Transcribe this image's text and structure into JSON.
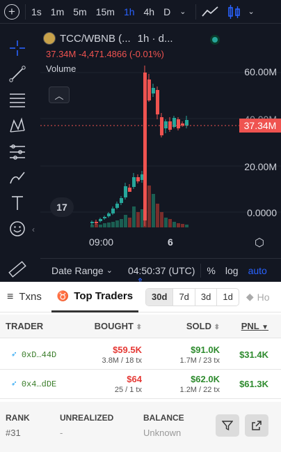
{
  "toolbar": {
    "timeframes": [
      "1s",
      "1m",
      "5m",
      "15m",
      "1h",
      "4h",
      "D"
    ],
    "active_timeframe": "1h"
  },
  "chart_header": {
    "symbol": "TCC/WBNB (...",
    "interval": "1h · d...",
    "ohlc_line": "37.34M -4,471.4866 (-0.01%)",
    "volume_label": "Volume"
  },
  "chart_data": {
    "type": "candlestick",
    "y_ticks": [
      "60.00M",
      "40.00M",
      "20.00M",
      "0.0000"
    ],
    "x_ticks": [
      "09:00",
      "6"
    ],
    "current_price_label": "37.34M",
    "accent_up": "#26a69a",
    "accent_down": "#ef5350"
  },
  "bottom_bar": {
    "date_range": "Date Range",
    "clock": "04:50:37 (UTC)",
    "percent": "%",
    "log": "log",
    "auto": "auto"
  },
  "tabs": {
    "txns": "Txns",
    "top_traders": "Top Traders",
    "periods": [
      "30d",
      "7d",
      "3d",
      "1d"
    ],
    "active_period": "30d",
    "holders": "Ho"
  },
  "table": {
    "headers": {
      "trader": "TRADER",
      "bought": "BOUGHT",
      "sold": "SOLD",
      "pnl": "PNL"
    },
    "rows": [
      {
        "trader": "0xD…44D",
        "bought_usd": "$59.5K",
        "bought_sub": "3.8M / 18 tx",
        "sold_usd": "$91.0K",
        "sold_sub": "1.7M / 23 tx",
        "pnl": "$31.4K"
      },
      {
        "trader": "0x4…dDE",
        "bought_usd": "$64",
        "bought_sub": "25 / 1 tx",
        "sold_usd": "$62.0K",
        "sold_sub": "1.2M / 22 tx",
        "pnl": "$61.3K"
      }
    ]
  },
  "detail": {
    "rank_label": "RANK",
    "rank_value": "#31",
    "unrealized_label": "UNREALIZED",
    "unrealized_value": "-",
    "balance_label": "BALANCE",
    "balance_value": "Unknown"
  }
}
